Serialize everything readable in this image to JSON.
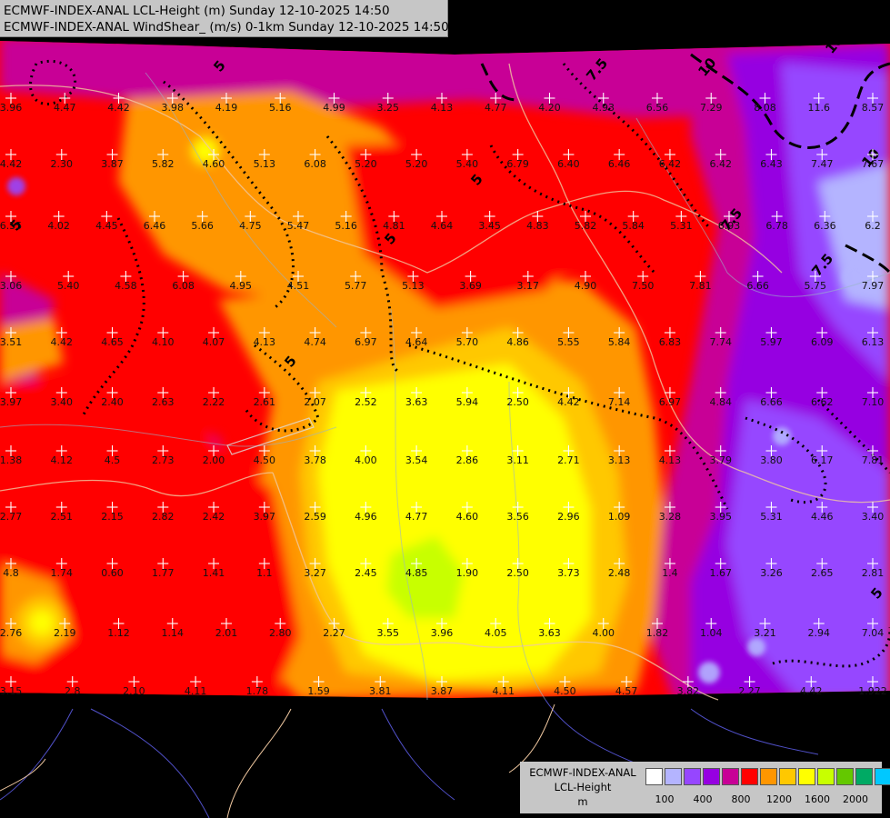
{
  "title": {
    "line1": "ECMWF-INDEX-ANAL LCL-Height (m) Sunday 12-10-2025 14:50",
    "line2": "ECMWF-INDEX-ANAL WindShear_ (m/s) 0-1km Sunday 12-10-2025 14:50"
  },
  "legend": {
    "line1": "ECMWF-INDEX-ANAL",
    "line2": "LCL-Height",
    "line3": "m",
    "colors": [
      "#ffffff",
      "#b4b4ff",
      "#9646ff",
      "#9600e1",
      "#c80096",
      "#ff0000",
      "#ff9600",
      "#ffc800",
      "#ffff00",
      "#c8ff00",
      "#64c800",
      "#00aa64",
      "#00c8ff"
    ],
    "ticks": [
      "100",
      "400",
      "800",
      "1200",
      "1600",
      "2000"
    ]
  },
  "windshear_contours": [
    "5",
    "5",
    "5",
    "5",
    "5",
    "7.5",
    "7.5",
    "7.5",
    "10",
    "10",
    "10",
    "5"
  ],
  "station_values": [
    [
      "3.96",
      "4.47",
      "4.42",
      "3.98",
      "4.19",
      "5.16",
      "4.99",
      "3.25",
      "4.13",
      "4.77",
      "4.20",
      "4.93",
      "6.56",
      "7.29",
      "8.08",
      "11.6",
      "8.57"
    ],
    [
      "4.42",
      "2.30",
      "3.87",
      "5.82",
      "4.60",
      "5.13",
      "6.08",
      "5.20",
      "5.20",
      "5.40",
      "6.79",
      "6.40",
      "6.46",
      "6.42",
      "6.42",
      "6.43",
      "7.47",
      "7.67"
    ],
    [
      "6.55",
      "4.02",
      "4.45",
      "6.46",
      "5.66",
      "4.75",
      "5.47",
      "5.16",
      "4.81",
      "4.64",
      "3.45",
      "4.83",
      "5.82",
      "5.84",
      "5.31",
      "6.93",
      "6.78",
      "6.36",
      "6.2"
    ],
    [
      "3.06",
      "5.40",
      "4.58",
      "6.08",
      "4.95",
      "4.51",
      "5.77",
      "5.13",
      "3.69",
      "3.17",
      "4.90",
      "7.50",
      "7.81",
      "6.66",
      "5.75",
      "7.97"
    ],
    [
      "3.51",
      "4.42",
      "4.65",
      "4.10",
      "4.07",
      "4.13",
      "4.74",
      "6.97",
      "4.64",
      "5.70",
      "4.86",
      "5.55",
      "5.84",
      "6.83",
      "7.74",
      "5.97",
      "6.09",
      "6.13"
    ],
    [
      "3.97",
      "3.40",
      "2.40",
      "2.63",
      "2.22",
      "2.61",
      "2.07",
      "2.52",
      "3.63",
      "5.94",
      "2.50",
      "4.42",
      "7.14",
      "6.97",
      "4.84",
      "6.66",
      "6.62",
      "7.10"
    ],
    [
      "1.38",
      "4.12",
      "4.5",
      "2.73",
      "2.00",
      "4.50",
      "3.78",
      "4.00",
      "3.54",
      "2.86",
      "3.11",
      "2.71",
      "3.13",
      "4.13",
      "3.79",
      "3.80",
      "6.17",
      "7.81"
    ],
    [
      "2.77",
      "2.51",
      "2.15",
      "2.82",
      "2.42",
      "3.97",
      "2.59",
      "4.96",
      "4.77",
      "4.60",
      "3.56",
      "2.96",
      "1.09",
      "3.28",
      "3.95",
      "5.31",
      "4.46",
      "3.40"
    ],
    [
      "4.8",
      "1.74",
      "0.60",
      "1.77",
      "1.41",
      "1.1",
      "3.27",
      "2.45",
      "4.85",
      "1.90",
      "2.50",
      "3.73",
      "2.48",
      "1.4",
      "1.67",
      "3.26",
      "2.65",
      "2.81"
    ],
    [
      "2.76",
      "2.19",
      "1.12",
      "1.14",
      "2.01",
      "2.80",
      "2.27",
      "3.55",
      "3.96",
      "4.05",
      "3.63",
      "4.00",
      "1.82",
      "1.04",
      "3.21",
      "2.94",
      "7.04"
    ],
    [
      "3.15",
      "2.8",
      "2.10",
      "4.11",
      "1.78",
      "1.59",
      "3.81",
      "3.87",
      "4.11",
      "4.50",
      "4.57",
      "3.82",
      "2.27",
      "4.42",
      "1.922"
    ]
  ]
}
